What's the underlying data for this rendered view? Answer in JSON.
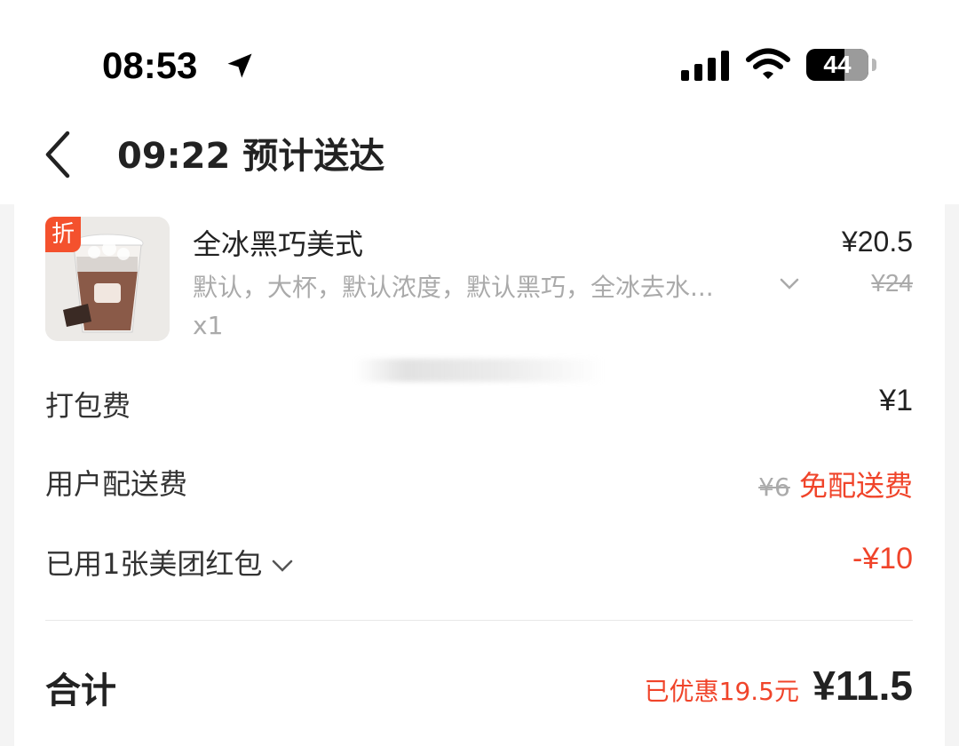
{
  "status_bar": {
    "time": "08:53",
    "battery": "44"
  },
  "nav": {
    "title": "09:22 预计送达"
  },
  "item": {
    "badge": "折",
    "name": "全冰黑巧美式",
    "specs": "默认，大杯，默认浓度，默认黑巧，全冰去水...",
    "qty": "x1",
    "price": "¥20.5",
    "original_price": "¥24"
  },
  "fees": {
    "packing_label": "打包费",
    "packing_value": "¥1",
    "delivery_label": "用户配送费",
    "delivery_original": "¥6",
    "delivery_value": "免配送费",
    "redpacket_label": "已用1张美团红包",
    "redpacket_value": "-¥10"
  },
  "summary": {
    "total_label": "合计",
    "saved": "已优惠19.5元",
    "total": "¥11.5"
  },
  "colors": {
    "accent_red": "#f0442a",
    "badge_orange": "#f4512d"
  }
}
